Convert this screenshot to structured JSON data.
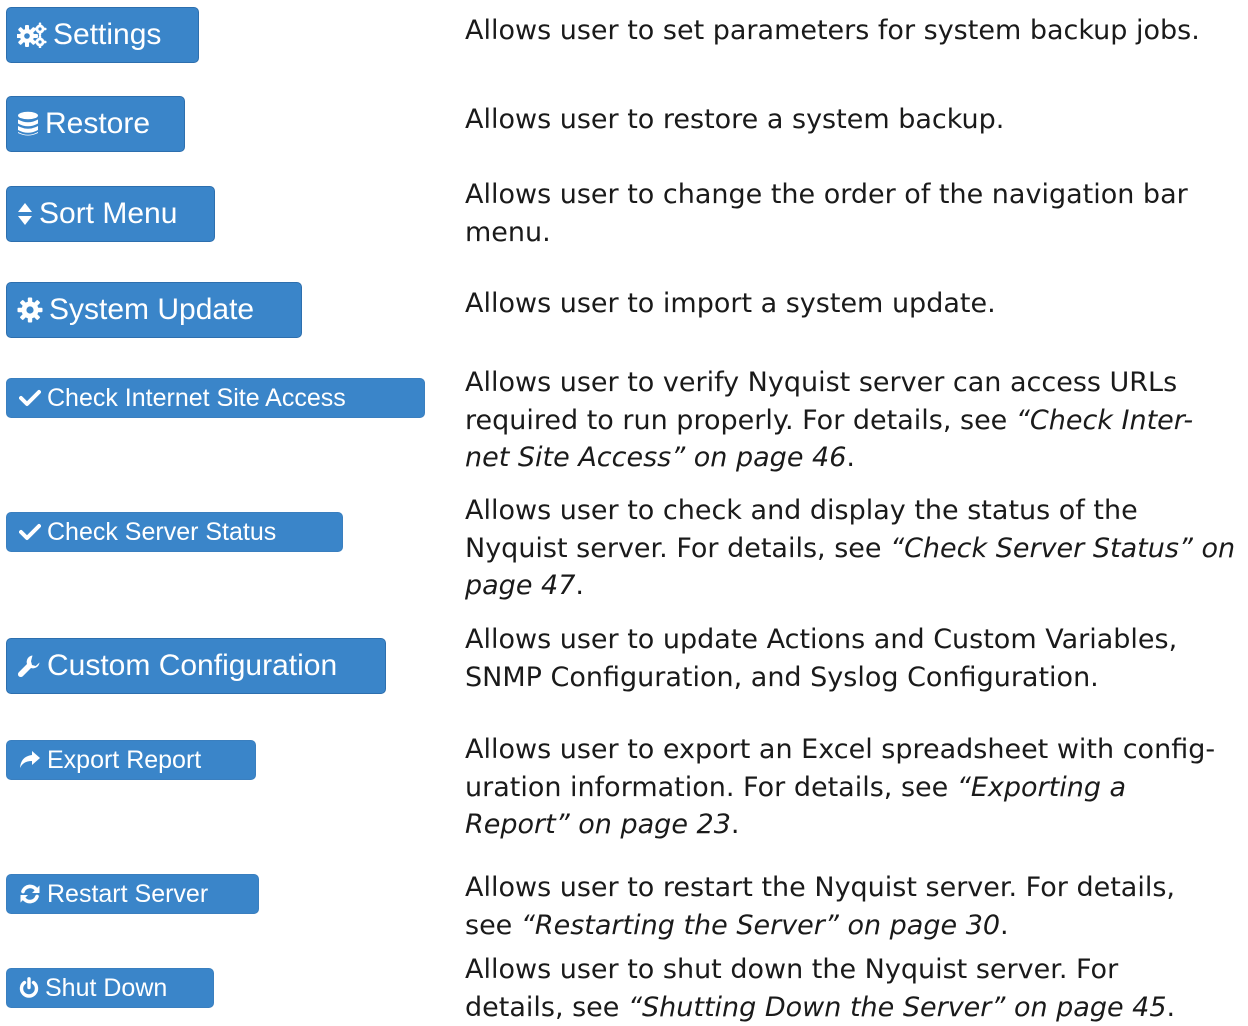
{
  "colors": {
    "button_bg": "#3a85c9",
    "button_text": "#ffffff",
    "body_text": "#1a1a1a"
  },
  "rows": [
    {
      "button": {
        "label": "Settings",
        "icon": "cogs-icon"
      },
      "desc": {
        "lines": [
          "Allows user to set parameters for system backup jobs."
        ]
      }
    },
    {
      "button": {
        "label": "Restore",
        "icon": "database-icon"
      },
      "desc": {
        "lines": [
          "Allows user to restore a system backup."
        ]
      }
    },
    {
      "button": {
        "label": "Sort Menu",
        "icon": "sort-icon"
      },
      "desc": {
        "lines": [
          "Allows user to change the order of the navigation bar",
          "menu."
        ]
      }
    },
    {
      "button": {
        "label": "System Update",
        "icon": "gear-icon"
      },
      "desc": {
        "lines": [
          "Allows user to import a system update."
        ]
      }
    },
    {
      "button": {
        "label": "Check Internet Site Access",
        "icon": "checkmark-icon"
      },
      "desc": {
        "line1": "Allows user to verify Nyquist server can access URLs",
        "line2_plain": "required to run properly. For details, see ",
        "line2_italic": "“Check Inter-",
        "line3_italic": "net Site Access” on page 46",
        "line3_end": "."
      }
    },
    {
      "button": {
        "label": "Check Server Status",
        "icon": "checkmark-icon"
      },
      "desc": {
        "line1": "Allows user to check and display the status of the",
        "line2_plain": "Nyquist server. For details, see ",
        "line2_italic": "“Check Server Status” on",
        "line3_italic": "page 47",
        "line3_end": "."
      }
    },
    {
      "button": {
        "label": "Custom Configuration",
        "icon": "wrench-icon"
      },
      "desc": {
        "lines": [
          "Allows user to update Actions and Custom Variables,",
          "SNMP Configuration, and Syslog Configuration."
        ]
      }
    },
    {
      "button": {
        "label": "Export Report",
        "icon": "share-arrow-icon"
      },
      "desc": {
        "line1": "Allows user to export an Excel spreadsheet with config-",
        "line2_plain": "uration information. For details, see ",
        "line2_italic": "“Exporting a",
        "line3_italic": "Report” on page 23",
        "line3_end": "."
      }
    },
    {
      "button": {
        "label": "Restart Server",
        "icon": "refresh-icon"
      },
      "desc": {
        "line1": "Allows user to restart the Nyquist server. For details,",
        "line2_plain": "see ",
        "line2_italic": "“Restarting the Server” on page 30",
        "line2_end": "."
      }
    },
    {
      "button": {
        "label": "Shut Down",
        "icon": "power-icon"
      },
      "desc": {
        "line1": "Allows user to shut down the Nyquist server. For",
        "line2_plain": "details, see ",
        "line2_italic": "“Shutting Down the Server” on page 45",
        "line2_end": "."
      }
    }
  ]
}
